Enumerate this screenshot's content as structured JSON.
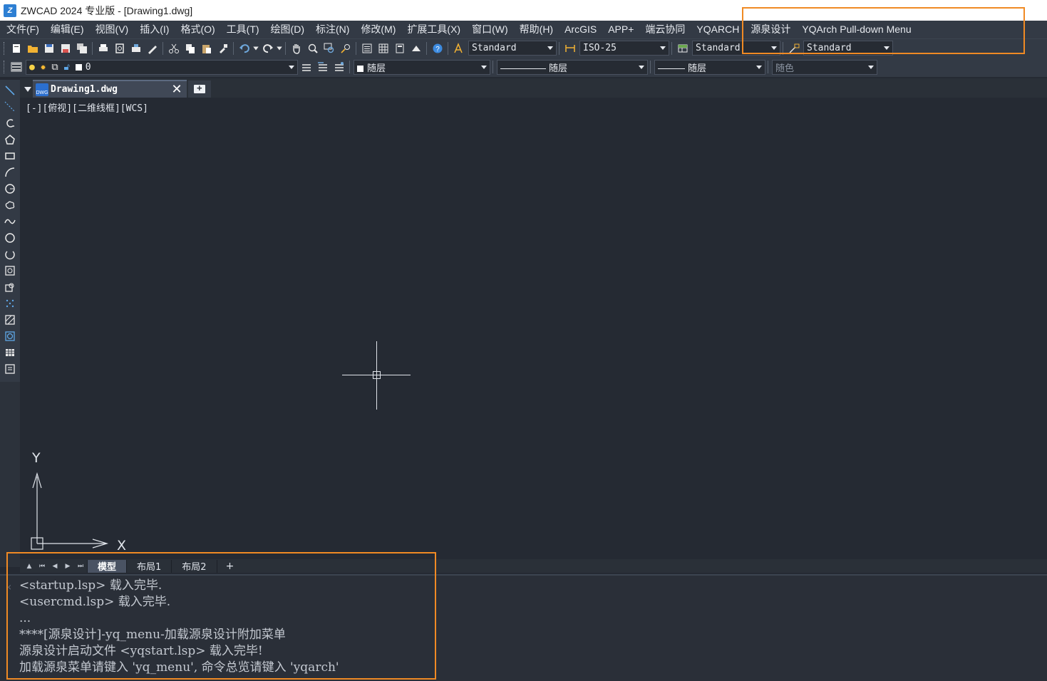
{
  "window": {
    "title": "ZWCAD 2024 专业版 - [Drawing1.dwg]"
  },
  "menubar": {
    "items": [
      {
        "id": "file",
        "label": "文件(F)"
      },
      {
        "id": "edit",
        "label": "编辑(E)"
      },
      {
        "id": "view",
        "label": "视图(V)"
      },
      {
        "id": "insert",
        "label": "插入(I)"
      },
      {
        "id": "format",
        "label": "格式(O)"
      },
      {
        "id": "tools",
        "label": "工具(T)"
      },
      {
        "id": "draw",
        "label": "绘图(D)"
      },
      {
        "id": "dimension",
        "label": "标注(N)"
      },
      {
        "id": "modify",
        "label": "修改(M)"
      },
      {
        "id": "ext-tools",
        "label": "扩展工具(X)"
      },
      {
        "id": "window",
        "label": "窗口(W)"
      },
      {
        "id": "help",
        "label": "帮助(H)"
      },
      {
        "id": "arcgis",
        "label": "ArcGIS"
      },
      {
        "id": "app-plus",
        "label": "APP+"
      },
      {
        "id": "cloud-collab",
        "label": "端云协同"
      },
      {
        "id": "yqarch",
        "label": "YQARCH"
      },
      {
        "id": "yuanquan-design",
        "label": "源泉设计"
      },
      {
        "id": "yqarch-pulldown",
        "label": "YQArch Pull-down Menu"
      }
    ]
  },
  "toolbar1": {
    "text_style": "Standard",
    "dim_style": "ISO-25",
    "table_style": "Standard",
    "multileader_style": "Standard"
  },
  "toolbar2": {
    "layer": "0",
    "color": "随层",
    "linetype": "随层",
    "lineweight": "随层",
    "plot_style": "随色"
  },
  "document_tab": {
    "label": "Drawing1.dwg",
    "close": "✕"
  },
  "viewport": {
    "label": "[-][俯视][二维线框][WCS]"
  },
  "ucs": {
    "x_label": "X",
    "y_label": "Y"
  },
  "layout_tabs": {
    "model": "模型",
    "layout1": "布局1",
    "layout2": "布局2",
    "add": "+"
  },
  "command_history": {
    "lines": [
      "<startup.lsp> 载入完毕.",
      "<usercmd.lsp> 载入完毕.",
      "...",
      "****[源泉设计]-yq_menu-加载源泉设计附加菜单",
      "源泉设计启动文件 <yqstart.lsp> 载入完毕!",
      "加载源泉菜单请键入 'yq_menu', 命令总览请键入 'yqarch'"
    ]
  },
  "colors": {
    "highlight": "#f08a24",
    "canvas": "#252a33",
    "chrome": "#333a45"
  }
}
